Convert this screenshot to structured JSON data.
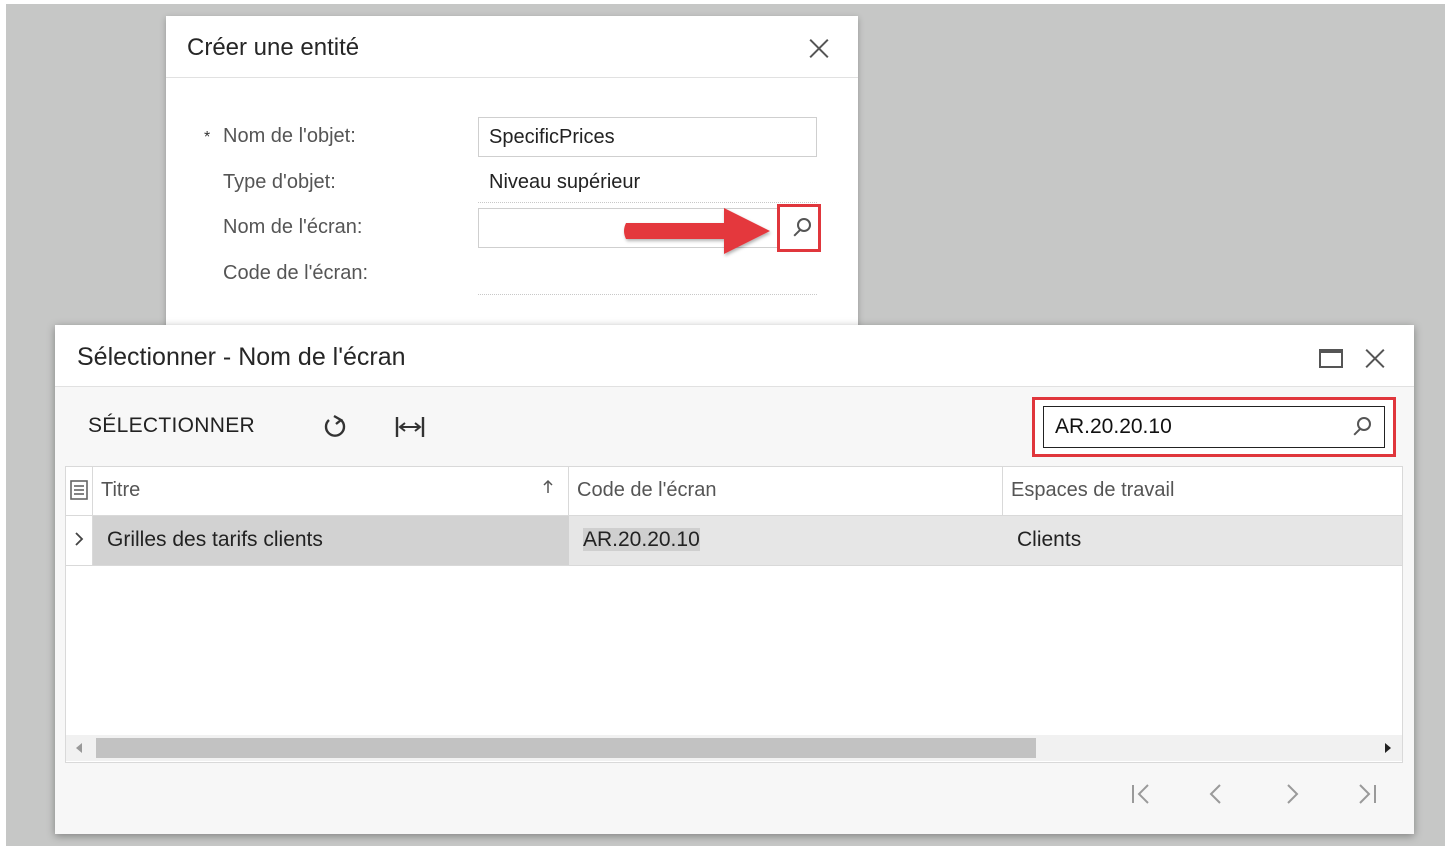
{
  "create_dialog": {
    "title": "Créer une entité",
    "required_marker": "*",
    "fields": {
      "object_name_label": "Nom de l'objet:",
      "object_name_value": "SpecificPrices",
      "object_type_label": "Type d'objet:",
      "object_type_value": "Niveau supérieur",
      "screen_name_label": "Nom de l'écran:",
      "screen_name_value": "",
      "screen_code_label": "Code de l'écran:"
    }
  },
  "select_dialog": {
    "title": "Sélectionner - Nom de l'écran",
    "toolbar": {
      "select_label": "SÉLECTIONNER",
      "search_value": "AR.20.20.10"
    },
    "grid": {
      "columns": [
        "Titre",
        "Code de l'écran",
        "Espaces de travail"
      ],
      "rows": [
        {
          "title": "Grilles des tarifs clients",
          "screen_code": "AR.20.20.10",
          "workspace": "Clients"
        }
      ]
    },
    "pager": {
      "first": "|<",
      "prev": "<",
      "next": ">",
      "last": ">|"
    }
  },
  "colors": {
    "highlight_red": "#e0363c",
    "backdrop": "#c6c7c6",
    "selected_row": "#e6e6e6"
  }
}
